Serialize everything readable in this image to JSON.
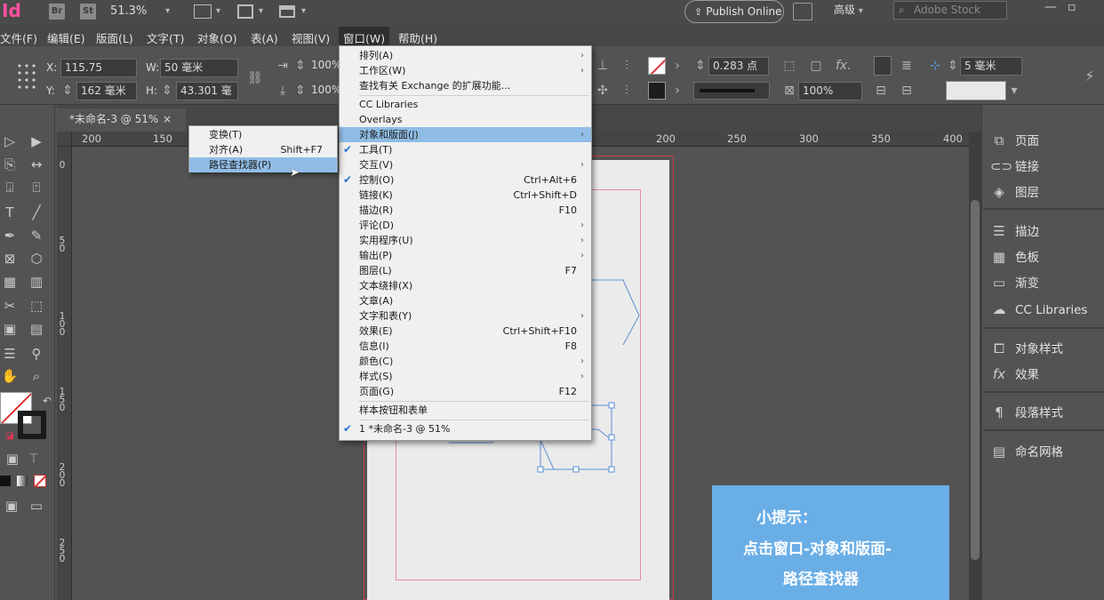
{
  "appbar": {
    "logo": "Id",
    "bridge_icon": "Br",
    "stock_icon": "St",
    "zoom": "51.3%",
    "publish_label": "Publish Online",
    "workspace": "高级",
    "search_placeholder": "Adobe Stock"
  },
  "menubar": {
    "items": [
      "文件(F)",
      "编辑(E)",
      "版面(L)",
      "文字(T)",
      "对象(O)",
      "表(A)",
      "视图(V)",
      "窗口(W)",
      "帮助(H)"
    ]
  },
  "control": {
    "x_label": "X:",
    "x_value": "115.75",
    "w_label": "W:",
    "w_value": "50 毫米",
    "y_label": "Y:",
    "y_value": "162 毫米",
    "h_label": "H:",
    "h_value": "43.301 毫",
    "scale_x": "100%",
    "scale_y": "100%",
    "stroke_weight": "0.283 点",
    "opacity": "100%",
    "gap": "5 毫米"
  },
  "document_tab": {
    "title": "*未命名-3 @ 51%",
    "close": "×"
  },
  "ruler": {
    "h_ticks": [
      "200",
      "150",
      "200",
      "250",
      "300",
      "350",
      "400"
    ],
    "v_ticks": [
      "0",
      "5 0",
      "1 0 0",
      "1 5 0",
      "2 0 0",
      "2 5 0"
    ]
  },
  "window_menu": {
    "items": [
      {
        "label": "排列(A)",
        "submenu": true
      },
      {
        "label": "工作区(W)",
        "submenu": true
      },
      {
        "label": "查找有关 Exchange 的扩展功能..."
      },
      {
        "label": "CC Libraries"
      },
      {
        "label": "Overlays"
      },
      {
        "label": "对象和版面(J)",
        "submenu": true,
        "highlighted": true
      },
      {
        "label": "工具(T)",
        "checked": true
      },
      {
        "label": "交互(V)",
        "submenu": true
      },
      {
        "label": "控制(O)",
        "checked": true,
        "shortcut": "Ctrl+Alt+6"
      },
      {
        "label": "链接(K)",
        "shortcut": "Ctrl+Shift+D"
      },
      {
        "label": "描边(R)",
        "shortcut": "F10"
      },
      {
        "label": "评论(D)",
        "submenu": true
      },
      {
        "label": "实用程序(U)",
        "submenu": true
      },
      {
        "label": "输出(P)",
        "submenu": true
      },
      {
        "label": "图层(L)",
        "shortcut": "F7"
      },
      {
        "label": "文本绕排(X)"
      },
      {
        "label": "文章(A)"
      },
      {
        "label": "文字和表(Y)",
        "submenu": true
      },
      {
        "label": "效果(E)",
        "shortcut": "Ctrl+Shift+F10"
      },
      {
        "label": "信息(I)",
        "shortcut": "F8"
      },
      {
        "label": "颜色(C)",
        "submenu": true
      },
      {
        "label": "样式(S)",
        "submenu": true
      },
      {
        "label": "页面(G)",
        "shortcut": "F12"
      },
      {
        "label": "样本按钮和表单"
      },
      {
        "label": "1 *未命名-3 @ 51%",
        "checked": true
      }
    ]
  },
  "sub_menu": {
    "items": [
      {
        "label": "变换(T)"
      },
      {
        "label": "对齐(A)",
        "shortcut": "Shift+F7"
      },
      {
        "label": "路径查找器(P)",
        "highlighted": true
      }
    ]
  },
  "panels": {
    "items": [
      {
        "label": "页面",
        "icon": "pages-icon"
      },
      {
        "label": "链接",
        "icon": "links-icon"
      },
      {
        "label": "图层",
        "icon": "layers-icon"
      },
      {
        "label": "描边",
        "icon": "stroke-icon"
      },
      {
        "label": "色板",
        "icon": "swatches-icon"
      },
      {
        "label": "渐变",
        "icon": "gradient-icon"
      },
      {
        "label": "CC Libraries",
        "icon": "cc-libraries-icon"
      },
      {
        "label": "对象样式",
        "icon": "object-styles-icon"
      },
      {
        "label": "效果",
        "icon": "effects-icon"
      },
      {
        "label": "段落样式",
        "icon": "paragraph-styles-icon"
      },
      {
        "label": "命名网格",
        "icon": "named-grids-icon"
      }
    ]
  },
  "tip": {
    "title": "小提示：",
    "line1": "点击窗口-对象和版面-",
    "line2": "路径查找器"
  },
  "colors": {
    "menu_highlight": "#90bde6",
    "tip_bg": "#6aaee6",
    "frame_stroke": "#5b8fd6",
    "bleed": "#c84050"
  }
}
